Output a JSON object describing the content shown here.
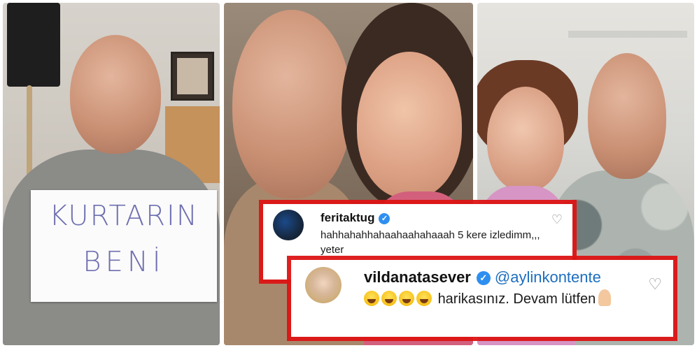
{
  "panels": {
    "left": {
      "sign_line1": "KURTARIN",
      "sign_line2": "BENİ"
    },
    "middle": {},
    "right": {}
  },
  "comments": [
    {
      "username": "feritaktug",
      "text": "hahhahahhahaahaahahaaah 5 kere izledimm,,, yeter",
      "verified_icon": "✓",
      "like_icon": "heart-outline-icon",
      "like_glyph": "♡"
    },
    {
      "username": "vildanatasever",
      "mention": "@aylinkontente",
      "text_after_emojis": "harikasınız. Devam lütfen",
      "emojis": [
        "tears-of-joy-emoji",
        "tears-of-joy-emoji",
        "tears-of-joy-emoji",
        "tears-of-joy-emoji"
      ],
      "end_emoji": "folded-hands-emoji",
      "verified_icon": "✓",
      "like_icon": "heart-outline-icon",
      "like_glyph": "♡"
    }
  ],
  "colors": {
    "highlight": "#dc1414",
    "verified": "#2f8ff0",
    "mention": "#1d6ebf",
    "sign_ink": "#6e6fb0"
  }
}
